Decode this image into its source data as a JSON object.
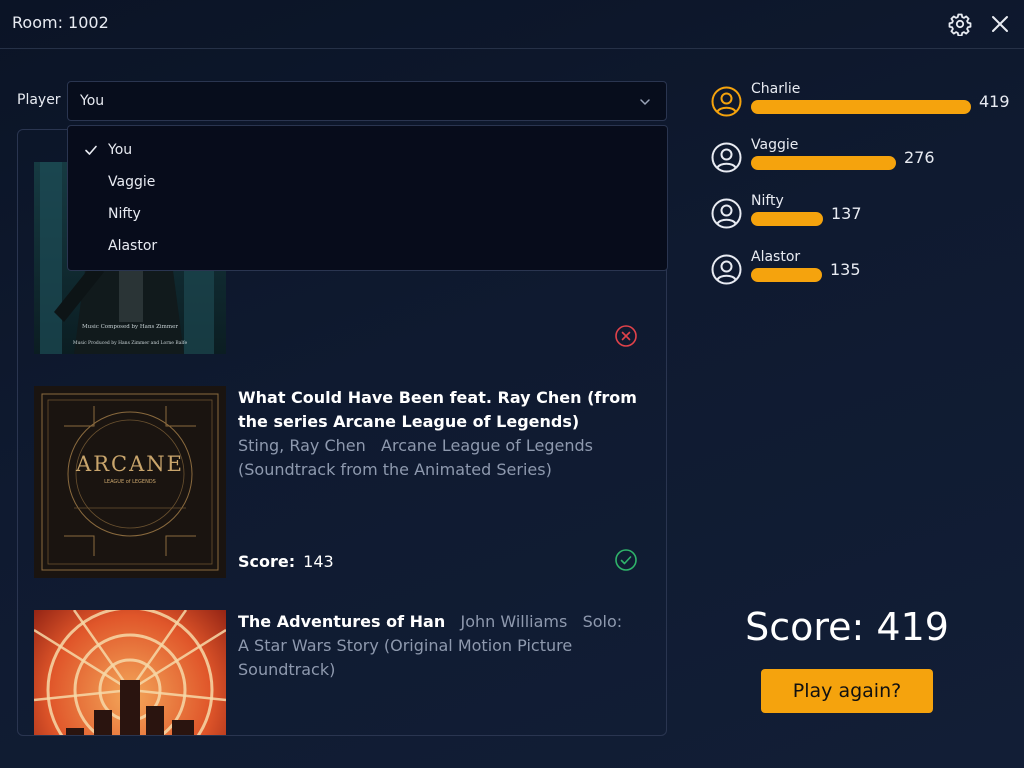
{
  "header": {
    "room_title": "Room: 1002",
    "settings_icon": "gear-icon",
    "close_icon": "close-icon"
  },
  "player_select": {
    "label": "Player",
    "value": "You",
    "options": [
      {
        "label": "You",
        "selected": true
      },
      {
        "label": "Vaggie",
        "selected": false
      },
      {
        "label": "Nifty",
        "selected": false
      },
      {
        "label": "Alastor",
        "selected": false
      }
    ]
  },
  "songs": [
    {
      "title": "",
      "artist": "",
      "album": "",
      "status": "wrong",
      "cover_text": [
        "Music Composed by Hans Zimmer",
        "Music Produced by Hans Zimmer and Lorne Balfe"
      ]
    },
    {
      "title": "What Could Have Been feat. Ray Chen (from the series Arcane League of Legends)",
      "artist": "Sting, Ray Chen",
      "album": "Arcane League of Legends (Soundtrack from the Animated Series)",
      "score_label": "Score:",
      "score_value": "143",
      "status": "correct",
      "cover_text": [
        "ARCANE",
        "LEAGUE of LEGENDS"
      ]
    },
    {
      "title": "The Adventures of Han",
      "artist": "John Williams",
      "album": "Solo: A Star Wars Story (Original Motion Picture Soundtrack)",
      "status": "none"
    }
  ],
  "leaderboard": [
    {
      "name": "Charlie",
      "score": "419",
      "highlight": true
    },
    {
      "name": "Vaggie",
      "score": "276",
      "highlight": false
    },
    {
      "name": "Nifty",
      "score": "137",
      "highlight": false
    },
    {
      "name": "Alastor",
      "score": "135",
      "highlight": false
    }
  ],
  "final": {
    "score_text": "Score: 419",
    "play_again_label": "Play again?"
  },
  "colors": {
    "accent": "#f5a30d",
    "background": "#0f1a30",
    "wrong": "#e0424a",
    "correct": "#2fb36a"
  }
}
